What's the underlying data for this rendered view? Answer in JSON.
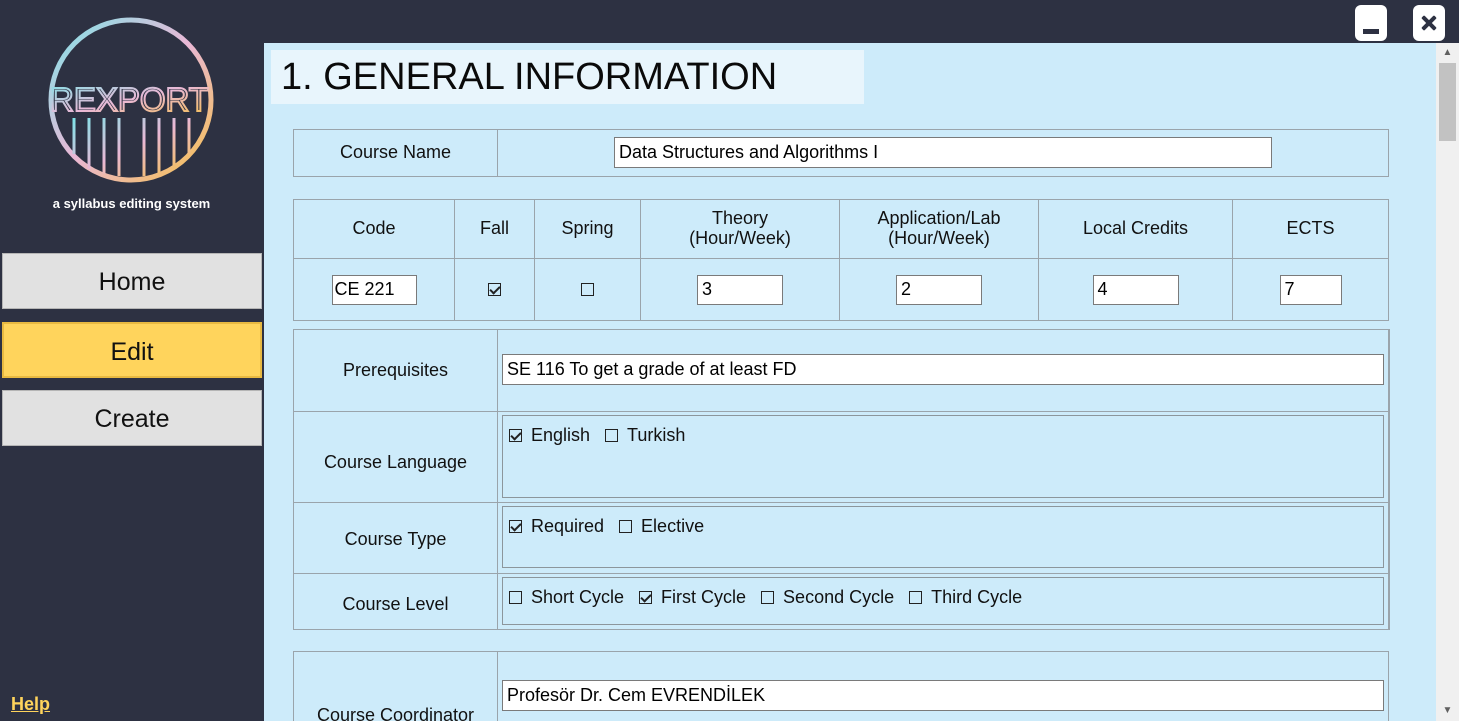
{
  "app": {
    "logo_text": "REXPORT",
    "tagline": "a syllabus editing system"
  },
  "nav": {
    "home": "Home",
    "edit": "Edit",
    "create": "Create",
    "help": "Help"
  },
  "section_title": "1. GENERAL INFORMATION",
  "course_name": {
    "label": "Course Name",
    "value": "Data Structures and Algorithms I"
  },
  "credits_table": {
    "headers": {
      "code": "Code",
      "fall": "Fall",
      "spring": "Spring",
      "theory": "Theory",
      "theory_unit": "(Hour/Week)",
      "application": "Application/Lab",
      "application_unit": "(Hour/Week)",
      "local_credits": "Local Credits",
      "ects": "ECTS"
    },
    "values": {
      "code": "CE 221",
      "fall_checked": true,
      "spring_checked": false,
      "theory": "3",
      "application": "2",
      "local_credits": "4",
      "ects": "7"
    }
  },
  "prerequisites": {
    "label": "Prerequisites",
    "value": "SE 116 To get a grade of at least FD"
  },
  "course_language": {
    "label": "Course Language",
    "options": [
      {
        "label": "English",
        "checked": true
      },
      {
        "label": "Turkish",
        "checked": false
      }
    ]
  },
  "course_type": {
    "label": "Course Type",
    "options": [
      {
        "label": "Required",
        "checked": true
      },
      {
        "label": "Elective",
        "checked": false
      }
    ]
  },
  "course_level": {
    "label": "Course Level",
    "options": [
      {
        "label": "Short Cycle",
        "checked": false
      },
      {
        "label": "First Cycle",
        "checked": true
      },
      {
        "label": "Second Cycle",
        "checked": false
      },
      {
        "label": "Third Cycle",
        "checked": false
      }
    ]
  },
  "course_coordinator": {
    "label": "Course Coordinator",
    "value": "Profesör Dr. Cem EVRENDİLEK"
  },
  "colors": {
    "sidebar_bg": "#2d3142",
    "content_bg": "#cdebfa",
    "active_nav": "#ffd45c",
    "help_link": "#ffd45c"
  }
}
